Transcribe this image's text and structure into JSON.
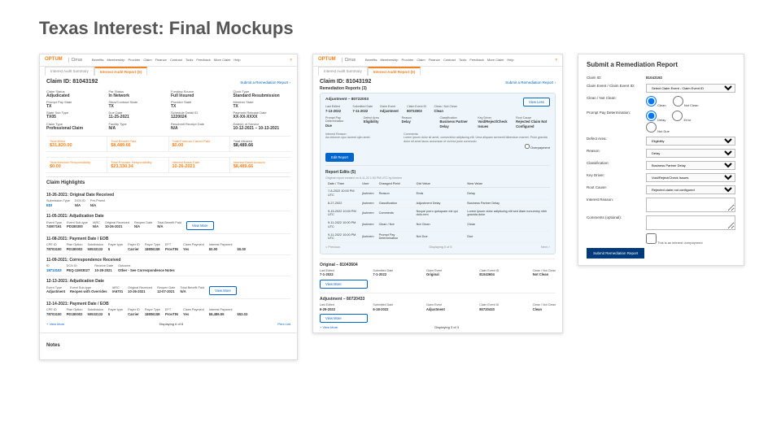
{
  "pageTitle": "Texas Interest: Final Mockups",
  "brand": {
    "optum": "OPTUM",
    "cirrus": "Cirrus"
  },
  "nav": [
    "Benefits",
    "Membership",
    "Provider",
    "Claim",
    "Finance",
    "Contract",
    "Tools",
    "Feedback",
    "More Claim",
    "Help"
  ],
  "tabs": {
    "summary": "Interest Audit Summary",
    "report": "Interest Audit Report (5)"
  },
  "left": {
    "claimId": "Claim ID: 81043192",
    "submitLink": "Submit a Remediation Report",
    "grid": [
      {
        "k": "Claim Status",
        "v": "Adjudicated"
      },
      {
        "k": "Par Status",
        "v": "In Network"
      },
      {
        "k": "Funding Source",
        "v": "Full Insured"
      },
      {
        "k": "Clock Type",
        "v": "Standard Resubmission"
      },
      {
        "k": "Prompt Pay State",
        "v": "TX"
      },
      {
        "k": "Situs/Contract State",
        "v": "TX"
      },
      {
        "k": "Provider State",
        "v": "TX"
      },
      {
        "k": "Member State",
        "v": "TX"
      },
      {
        "k": "State Sub Type",
        "v": "TX05"
      },
      {
        "k": "Due Date",
        "v": "11-25-2021"
      },
      {
        "k": "Schedule Detail ID",
        "v": "1220024"
      },
      {
        "k": "Payment Release Date",
        "v": "XX-XX-XXXX"
      },
      {
        "k": "Claim Type",
        "v": "Professional Claim"
      },
      {
        "k": "Facility Type",
        "v": "N/A"
      },
      {
        "k": "Resubmit Receipt Date",
        "v": "N/A"
      },
      {
        "k": "Date(s) of Service",
        "v": "10-12-2021 – 10-13-2021"
      }
    ],
    "tot1": [
      {
        "k": "Total Billed",
        "v": "$31,820.00"
      },
      {
        "k": "Total Benefit Paid",
        "v": "$8,489.66"
      },
      {
        "k": "Total External Carrier Paid",
        "v": "$0.00"
      },
      {
        "k": "Total Allowed",
        "v": "$8,489.66",
        "black": true
      }
    ],
    "tot2": [
      {
        "k": "Total Member Responsibility",
        "v": "$0.00"
      },
      {
        "k": "Total Provider Responsibility",
        "v": "$23,330.34"
      },
      {
        "k": "Interest Basis Date",
        "v": "10-26-2021"
      },
      {
        "k": "Interest Basis Amount",
        "v": "$8,489.66"
      }
    ],
    "hlTitle": "Claim Highlights",
    "viewMore": "View More",
    "hl": [
      {
        "hd": "10-26-2021: Original Date Received",
        "rows": [
          {
            "k": "Submission Type",
            "v": "EDI",
            "link": true
          },
          {
            "k": "DCN ID",
            "v": "N/A"
          },
          {
            "k": "Pre-Priced",
            "v": "N/A"
          }
        ]
      },
      {
        "hd": "11-05-2021: Adjudication Date",
        "rows": [
          {
            "k": "Event Type",
            "v": "74007161"
          },
          {
            "k": "Event Sub-type",
            "v": "PD180300"
          },
          {
            "k": "IARC",
            "v": "N/A"
          },
          {
            "k": "Original Received",
            "v": "10-26-2021"
          },
          {
            "k": "Reopen Date",
            "v": "N/A"
          },
          {
            "k": "Total Benefit Paid",
            "v": "N/A"
          }
        ],
        "btn": true
      },
      {
        "hd": "11-08-2021: Payment Date / EOB",
        "rows": [
          {
            "k": "CPE ID",
            "v": "78703100"
          },
          {
            "k": "Plan Option",
            "v": "PD180002"
          },
          {
            "k": "Subdivision",
            "v": "50533133"
          },
          {
            "k": "Payer type",
            "v": "5"
          },
          {
            "k": "Payer ID",
            "v": "Carrier"
          },
          {
            "k": "Payor Type",
            "v": "18806158"
          },
          {
            "k": "EFT",
            "v": "ProvTIN"
          },
          {
            "k": "Claim Payment",
            "v": "Yes"
          },
          {
            "k": "Interest Payment",
            "v": "$0.00"
          },
          {
            "k2": "$0.00"
          }
        ]
      },
      {
        "hd": "11-09-2021: Correspondence Received",
        "rows": [
          {
            "k": "ID",
            "v": "18713103",
            "link": true
          },
          {
            "k": "DCN ID",
            "v": "PEQ-11903027"
          },
          {
            "k": "Receive Date",
            "v": "10-28-2021"
          },
          {
            "k": "Outcome",
            "v": "Other - See Correspondence Notes"
          }
        ]
      },
      {
        "hd": "12-13-2021: Adjudication Date",
        "rows": [
          {
            "k": "Event Type",
            "v": "Adjustment"
          },
          {
            "k": "Event Sub-type",
            "v": "Reopen with Overrides"
          },
          {
            "k": "IARC",
            "v": "IA6701"
          },
          {
            "k": "Original Received",
            "v": "10-26-2021"
          },
          {
            "k": "Reopen Date",
            "v": "12-07-2021"
          },
          {
            "k": "Total Benefit Paid",
            "v": "N/A"
          }
        ],
        "btn": true
      },
      {
        "hd": "12-14-2021: Payment Date / EOB",
        "rows": [
          {
            "k": "CPE ID",
            "v": "78703100"
          },
          {
            "k": "Plan Option",
            "v": "PD180002"
          },
          {
            "k": "Subdivision",
            "v": "50533133"
          },
          {
            "k": "Payer type",
            "v": "5"
          },
          {
            "k": "Payer ID",
            "v": "Carrier"
          },
          {
            "k": "Payor Type",
            "v": "18806158"
          },
          {
            "k": "EFT",
            "v": "ProvTIN"
          },
          {
            "k": "Claim Payment",
            "v": "Yes"
          },
          {
            "k": "Interest Payment",
            "v": "$8,489.59"
          },
          {
            "k2": "$53.03"
          }
        ]
      }
    ],
    "foot": {
      "more": "+ View More",
      "display": "Displaying 6 of 8",
      "print": "Print List"
    },
    "notes": "Notes"
  },
  "mid": {
    "claimId": "Claim ID: 81043192",
    "submitLink": "Submit a Remediation Report",
    "remedTitle": "Remediation Reports (3)",
    "box": {
      "title": "Adjustment – 80722003",
      "viewLess": "View Less",
      "grid": [
        {
          "k": "Last Edited",
          "v": "7-13-2022"
        },
        {
          "k": "Submitted Date",
          "v": "7-11-2022"
        },
        {
          "k": "Claim Event",
          "v": "Adjustment"
        },
        {
          "k": "Claim Event ID",
          "v": "80722003"
        },
        {
          "k": "Clean / Not Clean",
          "v": "Clean"
        }
      ],
      "grid2": [
        {
          "k": "Prompt Pay Determination",
          "v": "Due"
        },
        {
          "k": "Defect Area",
          "v": "Eligibility"
        },
        {
          "k": "Reason",
          "v": "Delay"
        },
        {
          "k": "Classification",
          "v": "Business Partner Delay"
        },
        {
          "k": "Key Driver",
          "v": "Void/Reject/Check Issues"
        },
        {
          "k": "Root Cause",
          "v": "Rejected Claim Not Configured"
        }
      ],
      "irLabel": "Interest Reason:",
      "ir": "Aa dolorum cjuo laoreet ujim amet.",
      "commLabel": "Comments:",
      "comm": "Lorem ipsum dolor sit amet, consectetur adipiscing elit. Urna aliquam sermenit bibendum mareet. Proin gravida dolor sit amet lacus accumsan et viverra justo commodo.",
      "ovLabel": "Overpayment",
      "editBtn": "Edit Report"
    },
    "editsTitle": "Report Edits (5)",
    "editsSub": "Original report created on 8-11-22  1:53 PM UTC by kimiem",
    "th": [
      "Date / Time",
      "User",
      "Changed Field",
      "Old Value",
      "New Value"
    ],
    "rows": [
      [
        "7-8-2022\n10:00 PM UTC",
        "jkohnem",
        "Reason",
        "Ends",
        "Delay"
      ],
      [
        "8-27-2022\n",
        "jkohnem",
        "Classification",
        "Adjustment Delay",
        "Business Partner Delay"
      ],
      [
        "9-15-2022\n10:00 PM UTC",
        "jkohnem",
        "Comments",
        "Neque porro quisquam est qui dolo-rem",
        "Lorem ipsum dolor adipiscing elit sed diam nonummy nibh gravida dolor"
      ],
      [
        "9-11-2022\n10:00 PM UTC",
        "jkohnem",
        "Clean / Not",
        "Not Clean",
        "Clean"
      ],
      [
        "9-11-2022\n10:00 PM UTC",
        "jkohnem",
        "Prompt Pay Determination",
        "Not Due",
        "Due"
      ]
    ],
    "pager": {
      "prev": "< Previous",
      "disp": "Displaying 5 of 5",
      "next": "Next >"
    },
    "orig1": {
      "title": "Original – 81043604",
      "grid": [
        {
          "k": "Last Edited",
          "v": "7-1-2022"
        },
        {
          "k": "Submitted Date",
          "v": "7-1-2022"
        },
        {
          "k": "Claim Event",
          "v": "Original"
        },
        {
          "k": "Claim Event ID",
          "v": "81043604"
        },
        {
          "k": "Clean / Not Clean",
          "v": "Not Clean"
        }
      ]
    },
    "orig2": {
      "title": "Adjustment – 80720433",
      "grid": [
        {
          "k": "Last Edited",
          "v": "6-29-2022"
        },
        {
          "k": "Submitted Date",
          "v": "6-18-2022"
        },
        {
          "k": "Claim Event",
          "v": "Adjustment"
        },
        {
          "k": "Claim Event ID",
          "v": "80720433"
        },
        {
          "k": "Clean / Not Clean",
          "v": "Clean"
        }
      ]
    },
    "foot": {
      "more": "+ View More",
      "disp": "Displaying 3 of 3"
    }
  },
  "right": {
    "title": "Submit a Remediation Report",
    "rows": {
      "claimId": {
        "k": "Claim ID:",
        "v": "81043192"
      },
      "eventId": {
        "k": "Claim Event / Claim Event ID:",
        "ph": "Select Claim Event - Claim Event ID"
      },
      "clean": {
        "k": "Clean / Not Clean:",
        "a": "Clean",
        "b": "Not Clean"
      },
      "ppd": {
        "k": "Prompt Pay Determination:",
        "a": "Delay",
        "b": "Error",
        "c": "Not Due"
      },
      "defect": {
        "k": "Defect Area:",
        "v": "Eligibility"
      },
      "reason": {
        "k": "Reason:",
        "v": "Delay"
      },
      "class": {
        "k": "Classification:",
        "v": "Business Partner Delay"
      },
      "driver": {
        "k": "Key Driver:",
        "v": "Void/Reject/Check Issues"
      },
      "root": {
        "k": "Root Cause:",
        "v": "Rejected claim not configured"
      },
      "ir": {
        "k": "Interest Reason:"
      },
      "comm": {
        "k": "Comments (optional):"
      },
      "ov": "This is an interest overpayment"
    },
    "submit": "Submit Remediation Report"
  }
}
